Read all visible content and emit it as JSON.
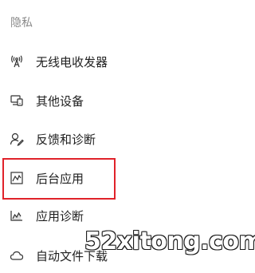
{
  "section": {
    "title": "隐私"
  },
  "nav": {
    "items": [
      {
        "label": "无线电收发器",
        "icon": "radio-icon"
      },
      {
        "label": "其他设备",
        "icon": "devices-icon"
      },
      {
        "label": "反馈和诊断",
        "icon": "feedback-icon"
      },
      {
        "label": "后台应用",
        "icon": "background-apps-icon"
      },
      {
        "label": "应用诊断",
        "icon": "app-diagnostics-icon"
      },
      {
        "label": "自动文件下载",
        "icon": "cloud-icon"
      }
    ]
  },
  "highlight": {
    "color": "#e0222a",
    "target": "后台应用"
  },
  "watermark": {
    "text": "52xitong.com"
  }
}
